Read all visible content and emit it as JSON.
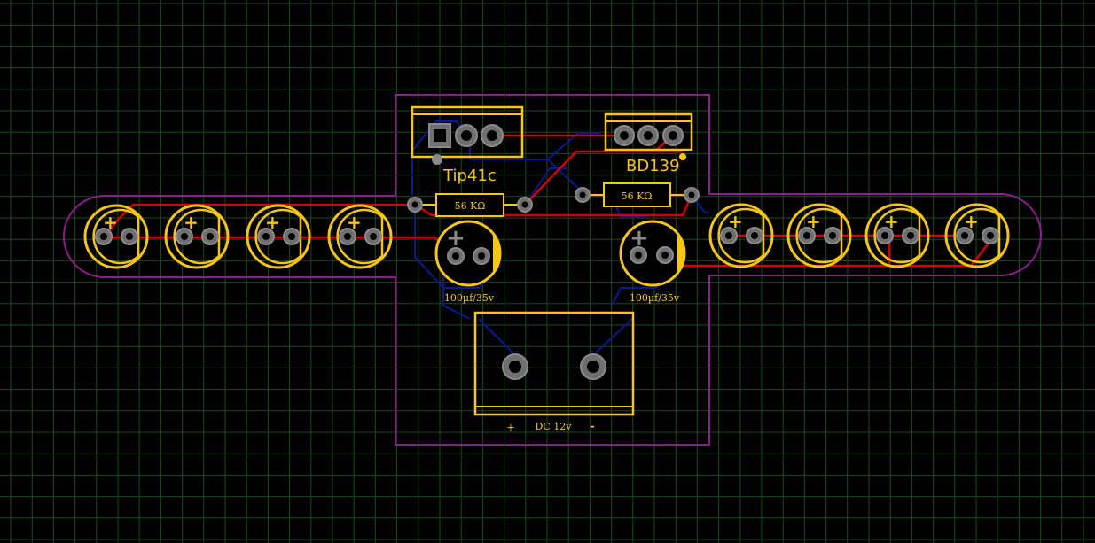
{
  "colors": {
    "background": "#000000",
    "grid": "#1b4a1b",
    "outline": "#8a1f8a",
    "silkscreen": "#f5c518",
    "top_copper": "#d40000",
    "bottom_copper": "#0a1a8c",
    "pad": "#6f6f6f",
    "pad_ring": "#8a8a8a"
  },
  "components": {
    "q1": {
      "label": "Tip41c"
    },
    "q2": {
      "label": "BD139"
    },
    "r1": {
      "value": "56 KΩ"
    },
    "r2": {
      "value": "56 KΩ"
    },
    "c1": {
      "value": "100µf/35v",
      "polarity": "+"
    },
    "c2": {
      "value": "100µf/35v",
      "polarity": "+"
    },
    "power_connector": {
      "label": "DC 12v",
      "plus": "+",
      "minus": "-"
    },
    "leds": {
      "polarity": "+",
      "count": 8
    }
  }
}
